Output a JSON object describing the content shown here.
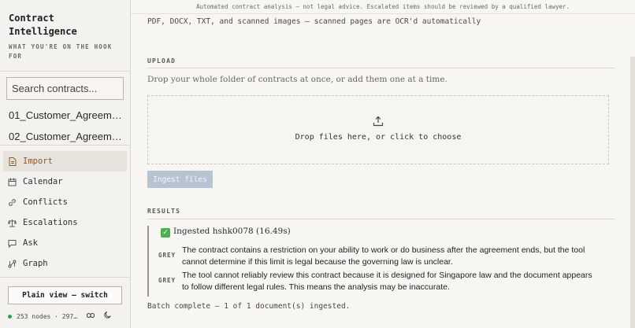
{
  "sidebar": {
    "brand": "Contract Intelligence",
    "tagline": "WHAT YOU'RE ON THE HOOK FOR",
    "search_placeholder": "Search contracts...",
    "contracts": [
      "01_Customer_Agreement...",
      "02_Customer_Agreement..."
    ],
    "nav": [
      {
        "label": "Import",
        "icon": "document-icon"
      },
      {
        "label": "Calendar",
        "icon": "calendar-icon"
      },
      {
        "label": "Conflicts",
        "icon": "link-icon"
      },
      {
        "label": "Escalations",
        "icon": "scale-icon"
      },
      {
        "label": "Ask",
        "icon": "chat-icon"
      },
      {
        "label": "Graph",
        "icon": "graph-icon"
      }
    ],
    "plain_view_label": "Plain view — switch",
    "status_text": "253 nodes · 297…"
  },
  "topbar": {
    "disclaimer": "Automated contract analysis — not legal advice. Escalated items should be reviewed by a qualified lawyer."
  },
  "main": {
    "formats_text": "PDF, DOCX, TXT, and scanned images — scanned pages are OCR'd automatically",
    "upload_label": "UPLOAD",
    "upload_hint": "Drop your whole folder of contracts at once, or add them one at a time.",
    "dropzone_text": "Drop files here, or click to choose",
    "ingest_button": "Ingest files",
    "results_label": "RESULTS",
    "result": {
      "title": "Ingested hshk0078 (16.49s)",
      "items": [
        {
          "tag": "GREY",
          "text": "The contract contains a restriction on your ability to work or do business after the agreement ends, but the tool cannot determine if this limit is legal because the governing law is unclear."
        },
        {
          "tag": "GREY",
          "text": "The tool cannot reliably review this contract because it is designed for Singapore law and the document appears to follow different legal rules. This means the analysis may be inaccurate."
        }
      ]
    },
    "batch_status": "Batch complete — 1 of 1 document(s) ingested."
  },
  "colors": {
    "accent": "#8a5a2e",
    "status_ok": "#3a9b58",
    "ingest_button_bg": "#b5c3d3",
    "check_green": "#4caf50"
  }
}
